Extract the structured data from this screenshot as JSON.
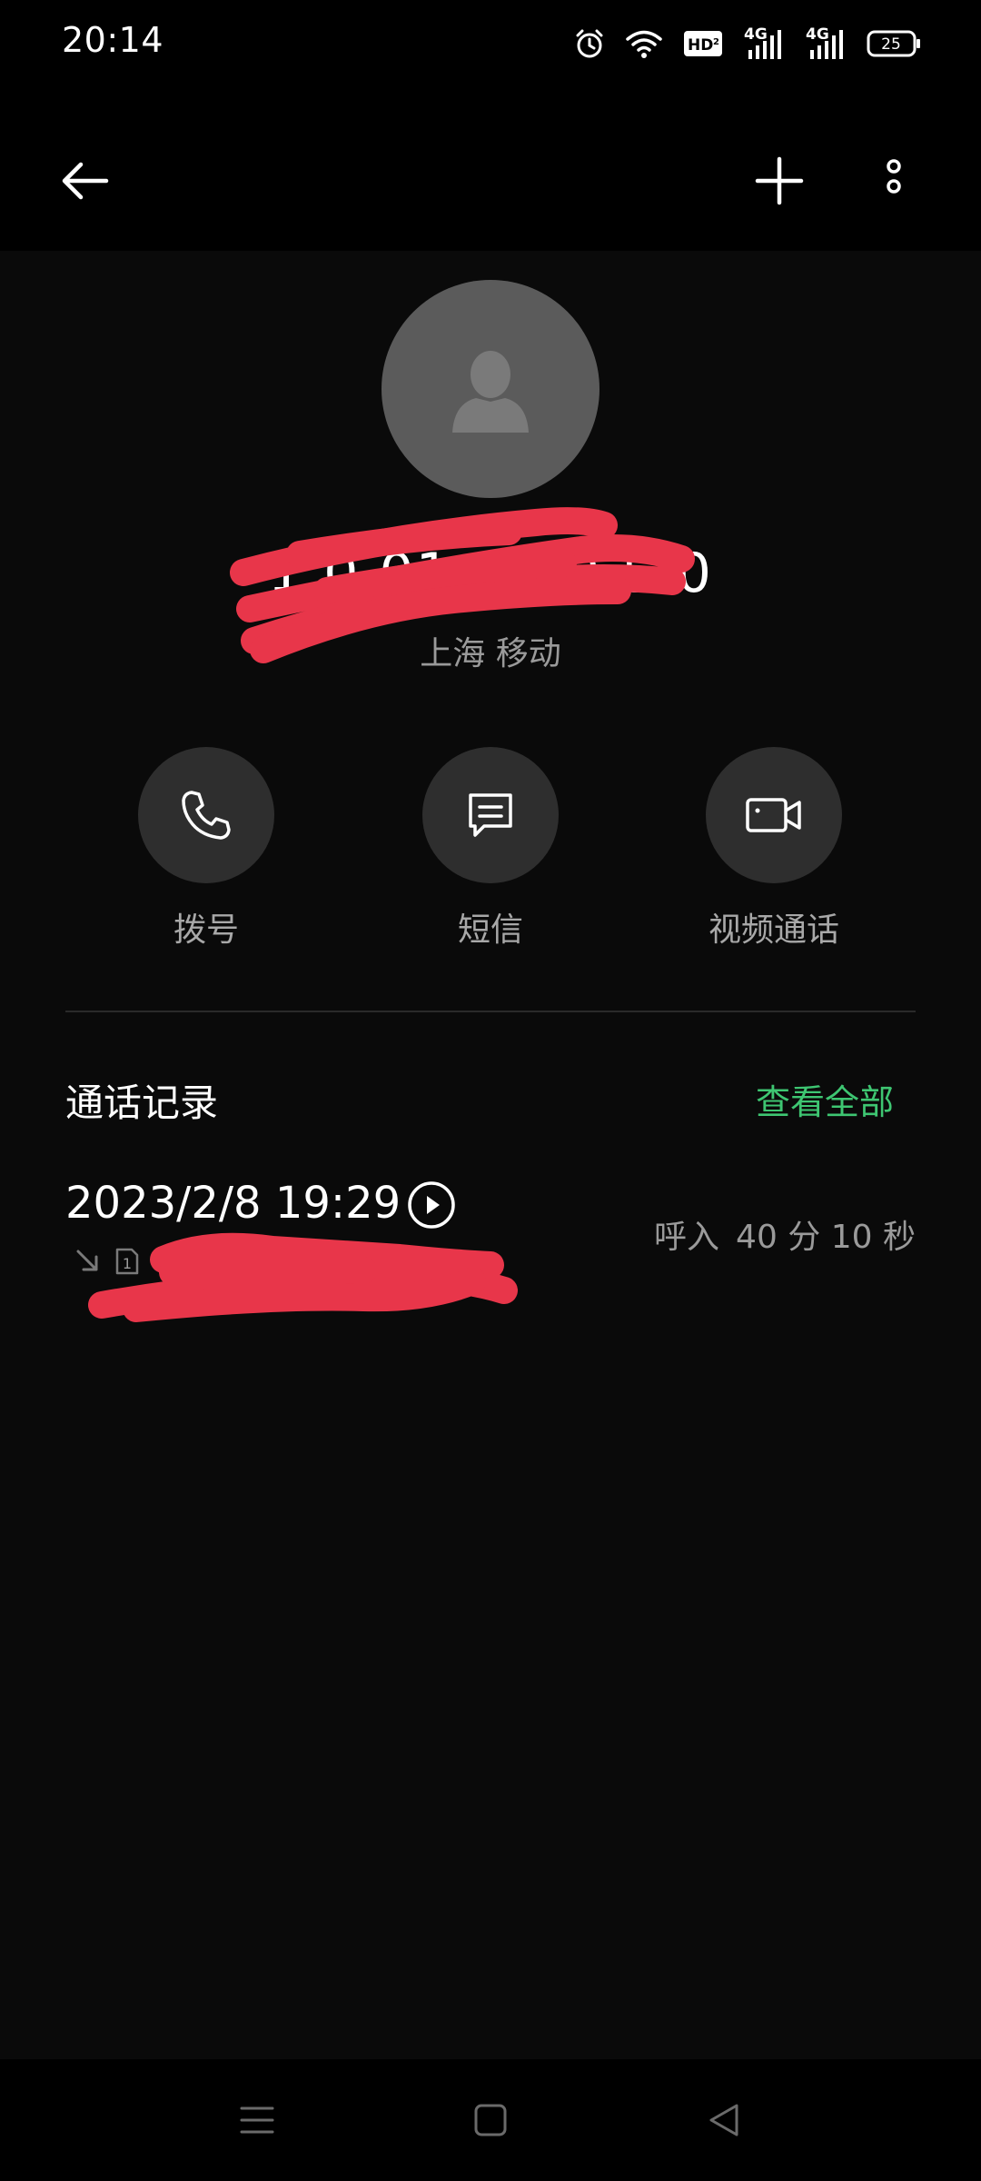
{
  "status_bar": {
    "time": "20:14",
    "hd_label": "HD",
    "hd_sub": "2",
    "network_1": "4G",
    "network_2": "4G",
    "battery": "25"
  },
  "app_bar": {
    "back_icon": "arrow-left-icon",
    "add_icon": "plus-icon",
    "more_icon": "more-vertical-icon"
  },
  "contact": {
    "avatar_icon": "person-icon",
    "phone_number": "1 0 01 0 . 0 5 0",
    "location": "上海 移动",
    "redaction_color": "#e8364a"
  },
  "actions": [
    {
      "label": "拨号",
      "icon": "phone-icon"
    },
    {
      "label": "短信",
      "icon": "message-icon"
    },
    {
      "label": "视频通话",
      "icon": "video-call-icon"
    }
  ],
  "call_log": {
    "title": "通话记录",
    "view_all": "查看全部",
    "accent_color": "#3ec672",
    "records": [
      {
        "datetime": "2023/2/8 19:29",
        "sim": "1",
        "type": "呼入",
        "duration": "40 分 10 秒"
      }
    ]
  },
  "nav_bar": {
    "menu_icon": "menu-icon",
    "home_icon": "home-square-icon",
    "back_icon": "back-triangle-icon"
  }
}
